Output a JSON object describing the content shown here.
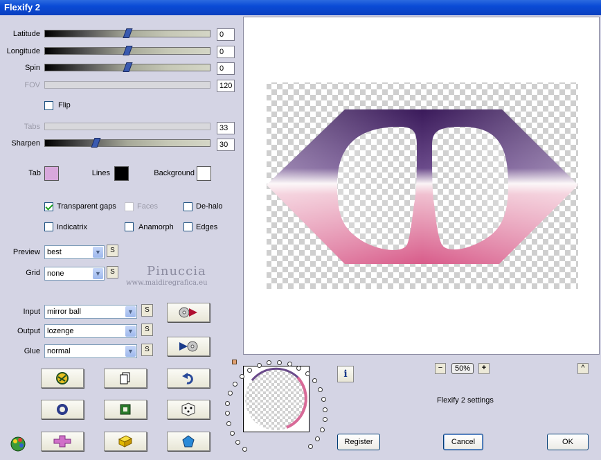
{
  "window": {
    "title": "Flexify 2"
  },
  "sliders": {
    "latitude": {
      "label": "Latitude",
      "value": "0"
    },
    "longitude": {
      "label": "Longitude",
      "value": "0"
    },
    "spin": {
      "label": "Spin",
      "value": "0"
    },
    "fov": {
      "label": "FOV",
      "value": "120"
    },
    "tabs": {
      "label": "Tabs",
      "value": "33"
    },
    "sharpen": {
      "label": "Sharpen",
      "value": "30"
    }
  },
  "flip": {
    "label": "Flip",
    "checked": false
  },
  "colors": {
    "tab_label": "Tab",
    "tab_color": "#d8a8dc",
    "lines_label": "Lines",
    "lines_color": "#000000",
    "background_label": "Background",
    "background_color": "#ffffff"
  },
  "options": {
    "transparent_gaps": {
      "label": "Transparent gaps",
      "checked": true
    },
    "faces": {
      "label": "Faces",
      "checked": false
    },
    "dehalo": {
      "label": "De-halo",
      "checked": false
    },
    "indicatrix": {
      "label": "Indicatrix",
      "checked": false
    },
    "anamorph": {
      "label": "Anamorph",
      "checked": false
    },
    "edges": {
      "label": "Edges",
      "checked": false
    }
  },
  "preview_select": {
    "label": "Preview",
    "value": "best"
  },
  "grid_select": {
    "label": "Grid",
    "value": "none"
  },
  "s_label": "S",
  "watermark": {
    "name": "Pinuccia",
    "site": "www.maidiregrafica.eu"
  },
  "input_select": {
    "label": "Input",
    "value": "mirror ball"
  },
  "output_select": {
    "label": "Output",
    "value": "lozenge"
  },
  "glue_select": {
    "label": "Glue",
    "value": "normal"
  },
  "zoom": {
    "minus": "−",
    "value": "50%",
    "plus": "+",
    "caret": "^"
  },
  "info_label": "i",
  "settings_name": "Flexify 2 settings",
  "buttons": {
    "register": "Register",
    "cancel": "Cancel",
    "ok": "OK"
  }
}
